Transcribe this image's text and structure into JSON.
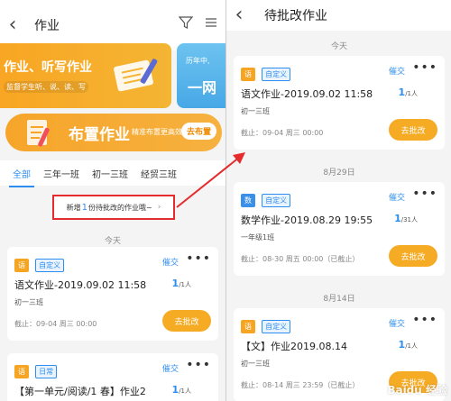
{
  "left": {
    "title": "作业",
    "banner1": {
      "title": "作业、听写作业",
      "subtitle": "监督学生听、说、读、写"
    },
    "banner2": {
      "subtitle": "历年中,",
      "title": "一网"
    },
    "assign_banner": {
      "title": "布置作业",
      "subtitle": "精准布置更高效",
      "button": "去布置"
    },
    "tabs": [
      "全部",
      "三年一班",
      "初一三班",
      "经贸三班"
    ],
    "notice": {
      "prefix": "新增",
      "count": "1",
      "suffix": "份待批改的作业哦~"
    },
    "date_sep": "今天",
    "cards": [
      {
        "subject": "语",
        "type": "自定义",
        "urge": "催交",
        "more": "•••",
        "name": "语文作业-2019.09.02 11:58",
        "count": "1",
        "count_unit": "/1人",
        "class": "初一三班",
        "deadline": "截止：09-04 周三 00:00",
        "action": "去批改"
      },
      {
        "subject": "语",
        "type": "日常",
        "urge": "催交",
        "more": "•••",
        "name": "【第一单元/阅读/1 春】作业2",
        "count": "1",
        "count_unit": "/1人"
      }
    ]
  },
  "right": {
    "title": "待批改作业",
    "groups": [
      {
        "date": "今天",
        "card": {
          "subject": "语",
          "type": "自定义",
          "urge": "催交",
          "more": "•••",
          "name": "语文作业-2019.09.02 11:58",
          "count": "1",
          "count_unit": "/1人",
          "class": "初一三班",
          "deadline": "截止：09-04 周三 00:00",
          "action": "去批改"
        }
      },
      {
        "date": "8月29日",
        "card": {
          "subject": "数",
          "type": "自定义",
          "urge": "催交",
          "more": "•••",
          "name": "数学作业-2019.08.29 19:55",
          "count": "1",
          "count_unit": "/31人",
          "class": "一年级1班",
          "deadline": "截止：08-30 周五 00:00（已截止）",
          "action": "去批改"
        }
      },
      {
        "date": "8月14日",
        "card": {
          "subject": "语",
          "type": "自定义",
          "urge": "催交",
          "more": "•••",
          "name": "【文】作业2019.08.14",
          "count": "1",
          "count_unit": "/1人",
          "class": "初一三班",
          "deadline": "截止：08-14 周三 23:59（已截止）",
          "action": "去批改"
        }
      }
    ]
  },
  "watermark": "Baidu 经验",
  "colors": {
    "accent": "#2e8ef0",
    "orange": "#f6ab25",
    "highlight_red": "#e52b2b"
  }
}
